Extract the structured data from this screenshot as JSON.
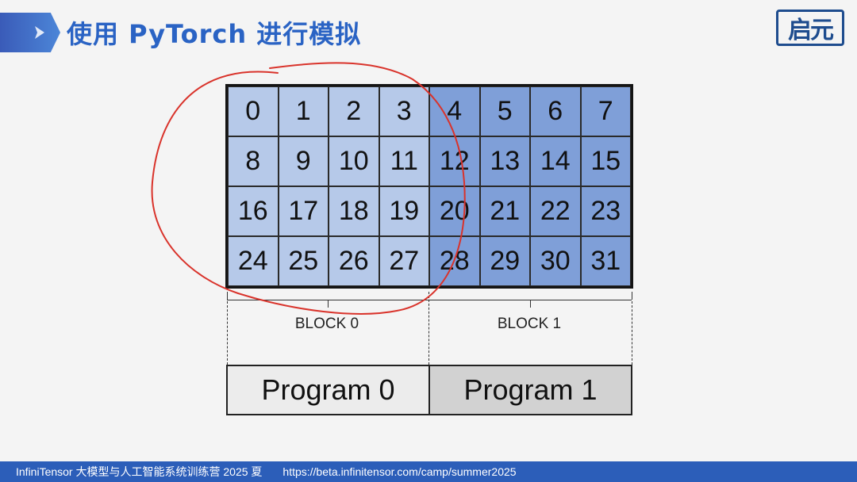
{
  "header": {
    "title": "使用 PyTorch 进行模拟",
    "logo_text": "启元"
  },
  "grid": {
    "rows": [
      [
        0,
        1,
        2,
        3,
        4,
        5,
        6,
        7
      ],
      [
        8,
        9,
        10,
        11,
        12,
        13,
        14,
        15
      ],
      [
        16,
        17,
        18,
        19,
        20,
        21,
        22,
        23
      ],
      [
        24,
        25,
        26,
        27,
        28,
        29,
        30,
        31
      ]
    ]
  },
  "blocks": {
    "block0_label": "BLOCK 0",
    "block1_label": "BLOCK 1"
  },
  "programs": {
    "program0_label": "Program 0",
    "program1_label": "Program 1"
  },
  "footer": {
    "camp_text": "InfiniTensor 大模型与人工智能系统训练营 2025 夏",
    "url_text": "https://beta.infinitensor.com/camp/summer2025"
  },
  "colors": {
    "block0_fill": "#b6c9e9",
    "block1_fill": "#7f9fd8",
    "program0_fill": "#ececec",
    "program1_fill": "#d2d2d2",
    "title_color": "#2a63c4",
    "footer_bg": "#2c5eb9",
    "annotation_stroke": "#d9332b"
  }
}
